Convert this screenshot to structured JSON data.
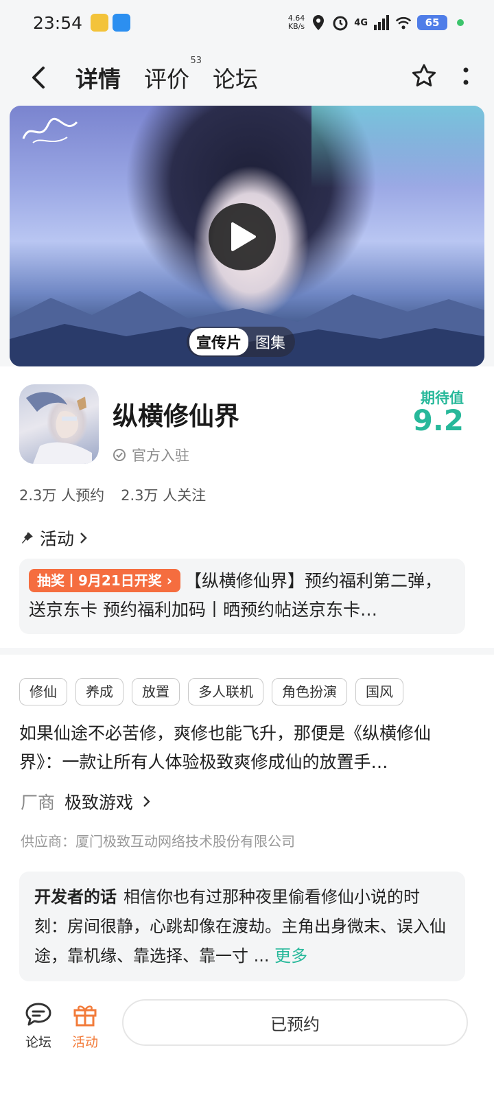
{
  "status_bar": {
    "time": "23:54",
    "net_speed_value": "4.64",
    "net_speed_unit": "KB/s",
    "network": "4G",
    "battery": "65",
    "icons": [
      "location-icon",
      "alarm-icon",
      "signal-icon",
      "wifi-icon",
      "battery-icon"
    ]
  },
  "nav": {
    "tabs": [
      {
        "label": "详情",
        "active": true
      },
      {
        "label": "评价",
        "badge": "53"
      },
      {
        "label": "论坛"
      }
    ]
  },
  "hero": {
    "media_tabs": [
      "宣传片",
      "图集"
    ]
  },
  "game": {
    "title": "纵横修仙界",
    "official": "官方入驻",
    "expect_label": "期待值",
    "expect_score": "9.2",
    "reservations": "2.3万 人预约",
    "followers": "2.3万 人关注"
  },
  "activity": {
    "header": "活动",
    "badge": "抽奖丨9月21日开奖",
    "text": "【纵横修仙界】预约福利第二弹，送京东卡 预约福利加码丨晒预约帖送京东卡…"
  },
  "tags": [
    "修仙",
    "养成",
    "放置",
    "多人联机",
    "角色扮演",
    "国风"
  ],
  "description": "如果仙途不必苦修，爽修也能飞升，那便是《纵横修仙界》：一款让所有人体验极致爽修成仙的放置手…",
  "vendor": {
    "label": "厂商",
    "name": "极致游戏"
  },
  "supplier": "供应商：厦门极致互动网络技术股份有限公司",
  "developer": {
    "label": "开发者的话",
    "text": "相信你也有过那种夜里偷看修仙小说的时刻：房间很静，心跳却像在渡劫。主角出身微末、误入仙途，靠机缘、靠选择、靠一寸 ...",
    "more": "更多"
  },
  "bottom": {
    "forum": "论坛",
    "activity": "活动",
    "reserve_button": "已预约"
  },
  "colors": {
    "accent": "#27b89a",
    "lottery": "#f56d3f",
    "activity_tab": "#f27b3a"
  }
}
